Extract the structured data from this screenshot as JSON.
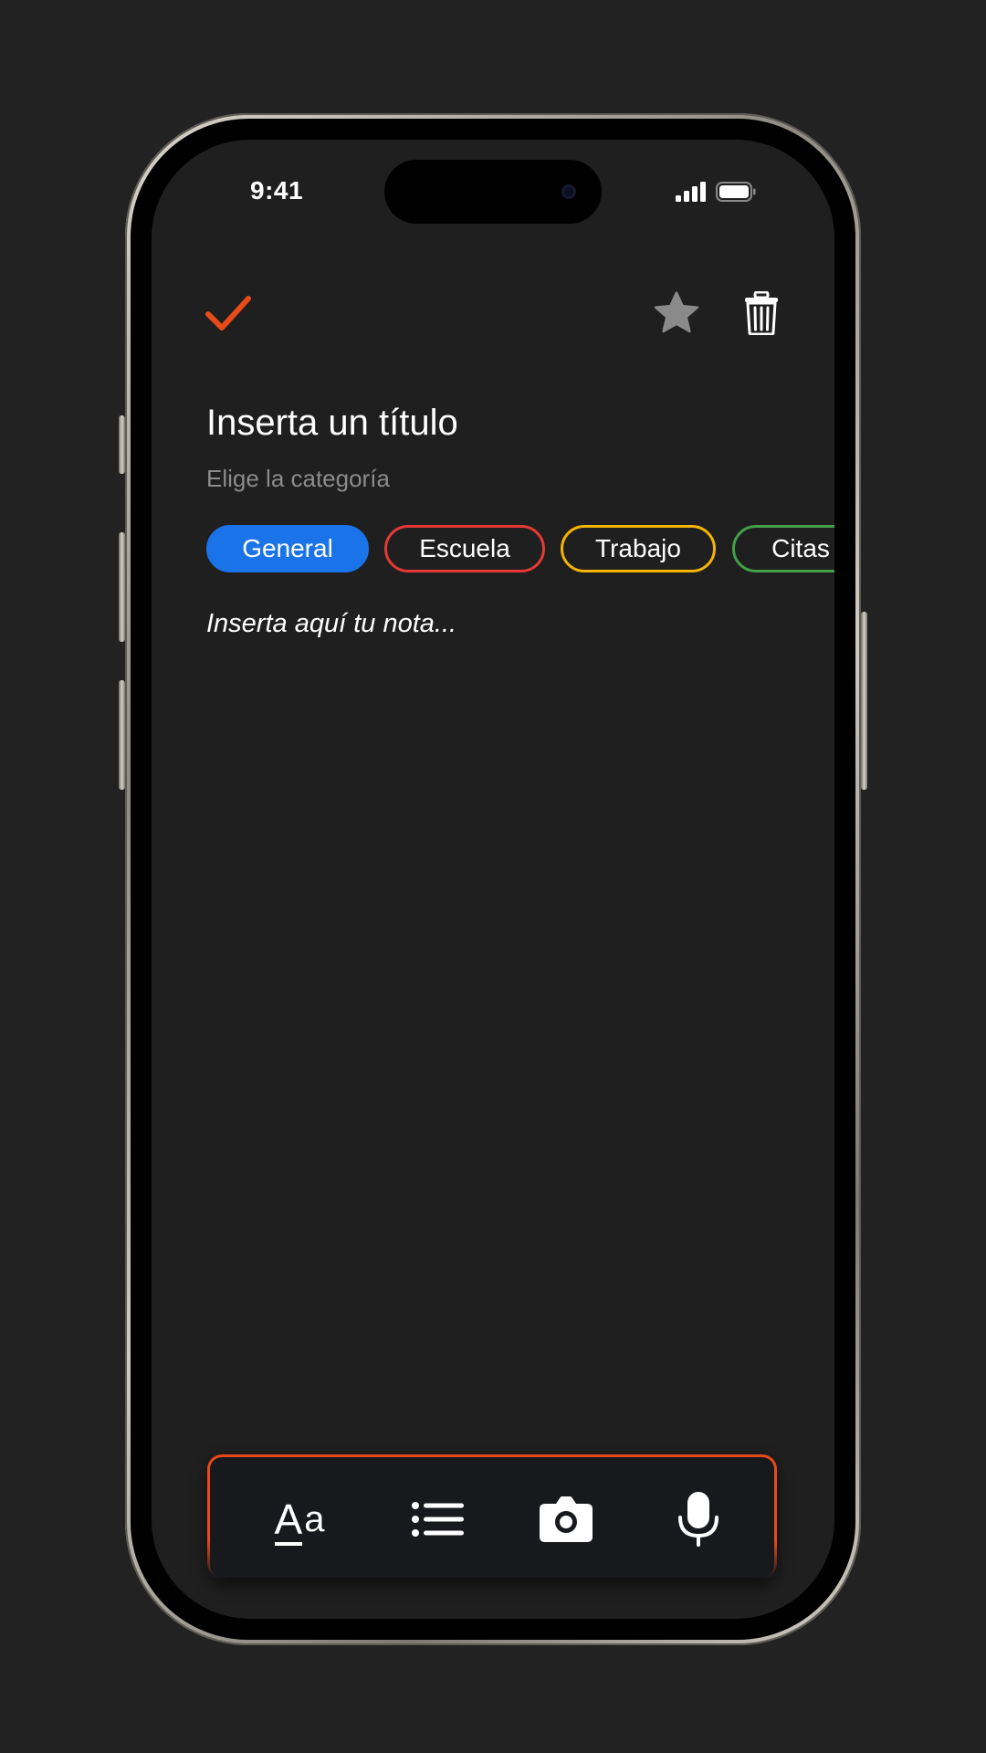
{
  "status_bar": {
    "time": "9:41"
  },
  "toolbar": {
    "confirm_icon": "checkmark-icon",
    "favorite_icon": "star-icon",
    "delete_icon": "trash-icon"
  },
  "note": {
    "title_placeholder": "Inserta un título",
    "category_label": "Elige la categoría",
    "body_placeholder": "Inserta aquí tu nota..."
  },
  "categories": [
    {
      "label": "General",
      "color": "#1a73e8",
      "selected": true
    },
    {
      "label": "Escuela",
      "color": "#e53935",
      "selected": false
    },
    {
      "label": "Trabajo",
      "color": "#f4b400",
      "selected": false
    },
    {
      "label": "Citas",
      "color": "#43a047",
      "selected": false
    }
  ],
  "format_toolbar": {
    "text_icon_label": "Aa",
    "items": [
      "text-format-icon",
      "list-icon",
      "camera-icon",
      "microphone-icon"
    ]
  },
  "colors": {
    "accent": "#e84a1a",
    "background": "#1f1f1f",
    "favorite_gray": "#8a8a8a"
  }
}
